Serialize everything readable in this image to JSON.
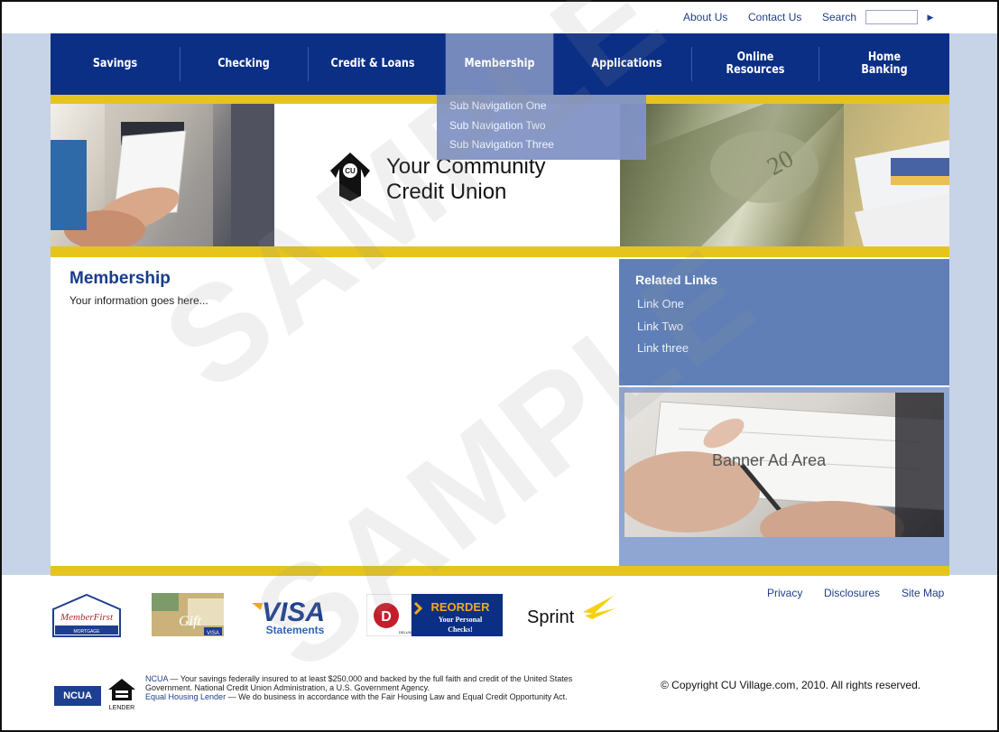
{
  "utility_nav": {
    "about": "About Us",
    "contact": "Contact Us",
    "search_label": "Search",
    "search_go": "▶"
  },
  "main_nav": [
    {
      "label": "Savings"
    },
    {
      "label": "Checking"
    },
    {
      "label": "Credit & Loans"
    },
    {
      "label": "Membership"
    },
    {
      "label": "Applications"
    },
    {
      "label": "Online Resources"
    },
    {
      "label": "Home Banking"
    }
  ],
  "dropdown": [
    "Sub Navigation One",
    "Sub Navigation Two",
    "Sub Navigation Three"
  ],
  "brand": {
    "mark": "CU",
    "line1": "Your Community",
    "line2": "Credit Union"
  },
  "content": {
    "title": "Membership",
    "body": "Your information goes here..."
  },
  "related_links": {
    "title": "Related Links",
    "items": [
      "Link One",
      "Link Two",
      "Link three"
    ]
  },
  "banner": {
    "text": "Banner Ad Area"
  },
  "footer_links": [
    "Privacy",
    "Disclosures",
    "Site Map"
  ],
  "partner_logos": {
    "memberfirst": {
      "name": "MemberFirst",
      "sub": "MORTGAGE"
    },
    "gift": {
      "name": "Gift",
      "badge": "VISA"
    },
    "visa": {
      "name": "VISA",
      "sub": "Statements"
    },
    "deluxe": {
      "brand": "DELUXE CORP",
      "line1": "REORDER",
      "line2": "Your Personal",
      "line3": "Checks!"
    },
    "sprint": {
      "name": "Sprint"
    }
  },
  "legal": {
    "ncua_badge": "NCUA",
    "lender_badge": "LENDER",
    "ncua_label": "NCUA",
    "ncua_text": " — Your savings federally insured to at least $250,000 and backed by the full faith and credit of the United States Government. National Credit Union Administration, a U.S. Government Agency.",
    "ehl_label": "Equal Housing Lender",
    "ehl_text": " — We do business in accordance with the Fair Housing Law and Equal Credit Opportunity Act."
  },
  "copyright": "© Copyright CU Village.com, 2010. All rights reserved.",
  "watermark": "SAMPLE",
  "colors": {
    "nav_blue": "#0b2f85",
    "gold": "#e6c41e",
    "related_blue": "#5f7fb6",
    "side_band": "#c7d3e6",
    "link_blue": "#1f3f8a"
  }
}
